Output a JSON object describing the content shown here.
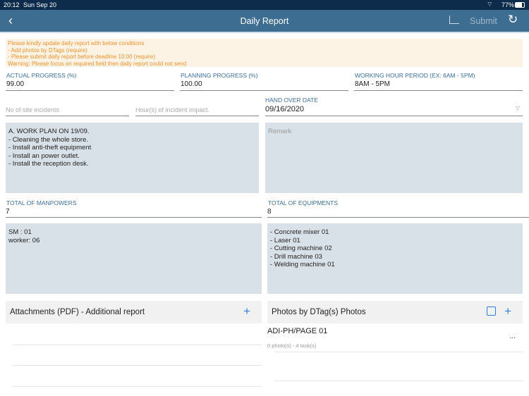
{
  "status": {
    "time": "20:12",
    "date": "Sun Sep 20",
    "battery": "77%"
  },
  "nav": {
    "title": "Daily Report",
    "submit": "Submit"
  },
  "notice": [
    "Please kindly update daily report with below conditions",
    "- Add photos by DTags (require)",
    "- Please submit daily report before deadline 10:00 (require)",
    "Warning: Please focus on required field then daily report could not send"
  ],
  "fields": {
    "actual_label": "ACTUAL PROGRESS (%)",
    "actual_value": "99.00",
    "planning_label": "PLANNING PROGRESS (%)",
    "planning_value": "100.00",
    "working_label": "WORKING HOUR PERIOD (EX: 6AM - 5PM)",
    "working_value": "8AM - 5PM",
    "incidents_placeholder": "No of site incidents",
    "impact_placeholder": "Hour(s) of incident impact.",
    "handover_label": "HAND OVER DATE",
    "handover_value": "09/16/2020",
    "workplan": "A. WORK PLAN ON 19/09.\n- Cleaning the whole store.\n- Install anti-theft equipment\n- Install an power outlet.\n- Install the reception desk.",
    "remark_placeholder": "Remark",
    "manpower_label": "TOTAL OF MANPOWERS",
    "manpower_value": "7",
    "equipment_label": "TOTAL OF EQUIPMENTS",
    "equipment_value": "8",
    "manpower_detail": "SM : 01\nworker: 06",
    "equipment_detail": "- Concrete mixer 01\n- Laser 01\n- Cutting machine 02\n- Drill machine 03\n- Welding machine 01"
  },
  "attachments": {
    "title": "Attachments (PDF) - Additional report"
  },
  "photos": {
    "title": "Photos by DTag(s) Photos",
    "item_title": "ADI-PH/PAGE 01",
    "item_sub": "0 photo(s) - 4 task(s)",
    "more": "..."
  }
}
